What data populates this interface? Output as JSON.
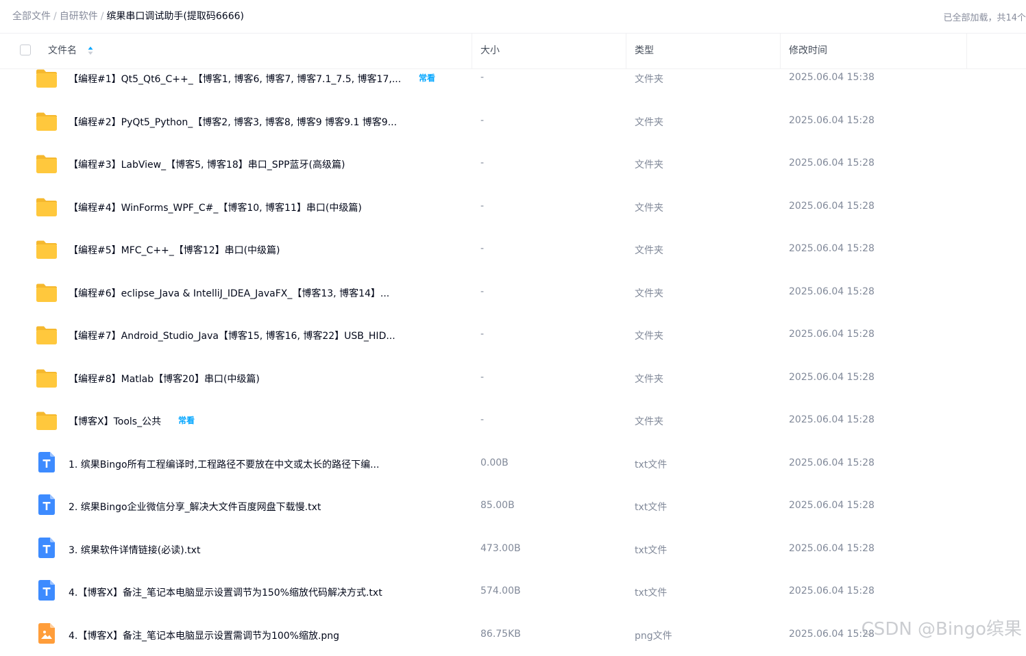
{
  "breadcrumb": {
    "items": [
      "全部文件",
      "自研软件",
      "缤果串口调试助手(提取码6666)"
    ],
    "separator": "/"
  },
  "status": {
    "loaded_text": "已全部加载，共14个"
  },
  "table": {
    "headers": {
      "name": "文件名",
      "size": "大小",
      "type": "类型",
      "modified": "修改时间"
    },
    "rows": [
      {
        "name": "【编程#1】Qt5_Qt6_C++_【博客1, 博客6, 博客7, 博客7.1_7.5, 博客17,...",
        "tag": "常看",
        "size": "-",
        "type": "文件夹",
        "modified": "2025.06.04 15:38",
        "icon": "folder-icon"
      },
      {
        "name": "【编程#2】PyQt5_Python_【博客2, 博客3, 博客8, 博客9 博客9.1 博客9...",
        "tag": "",
        "size": "-",
        "type": "文件夹",
        "modified": "2025.06.04 15:28",
        "icon": "folder-icon"
      },
      {
        "name": "【编程#3】LabView_【博客5, 博客18】串口_SPP蓝牙(高级篇)",
        "tag": "",
        "size": "-",
        "type": "文件夹",
        "modified": "2025.06.04 15:28",
        "icon": "folder-icon"
      },
      {
        "name": "【编程#4】WinForms_WPF_C#_【博客10, 博客11】串口(中级篇)",
        "tag": "",
        "size": "-",
        "type": "文件夹",
        "modified": "2025.06.04 15:28",
        "icon": "folder-icon"
      },
      {
        "name": "【编程#5】MFC_C++_【博客12】串口(中级篇)",
        "tag": "",
        "size": "-",
        "type": "文件夹",
        "modified": "2025.06.04 15:28",
        "icon": "folder-icon"
      },
      {
        "name": "【编程#6】eclipse_Java & IntelliJ_IDEA_JavaFX_【博客13, 博客14】...",
        "tag": "",
        "size": "-",
        "type": "文件夹",
        "modified": "2025.06.04 15:28",
        "icon": "folder-icon"
      },
      {
        "name": "【编程#7】Android_Studio_Java【博客15, 博客16, 博客22】USB_HID...",
        "tag": "",
        "size": "-",
        "type": "文件夹",
        "modified": "2025.06.04 15:28",
        "icon": "folder-icon"
      },
      {
        "name": "【编程#8】Matlab【博客20】串口(中级篇)",
        "tag": "",
        "size": "-",
        "type": "文件夹",
        "modified": "2025.06.04 15:28",
        "icon": "folder-icon"
      },
      {
        "name": "【博客X】Tools_公共",
        "tag": "常看",
        "size": "-",
        "type": "文件夹",
        "modified": "2025.06.04 15:28",
        "icon": "folder-icon"
      },
      {
        "name": "1. 缤果Bingo所有工程编译时,工程路径不要放在中文或太长的路径下编...",
        "tag": "",
        "size": "0.00B",
        "type": "txt文件",
        "modified": "2025.06.04 15:28",
        "icon": "txt-file-icon"
      },
      {
        "name": "2. 缤果Bingo企业微信分享_解决大文件百度网盘下载慢.txt",
        "tag": "",
        "size": "85.00B",
        "type": "txt文件",
        "modified": "2025.06.04 15:28",
        "icon": "txt-file-icon"
      },
      {
        "name": "3. 缤果软件详情链接(必读).txt",
        "tag": "",
        "size": "473.00B",
        "type": "txt文件",
        "modified": "2025.06.04 15:28",
        "icon": "txt-file-icon"
      },
      {
        "name": "4.【博客X】备注_笔记本电脑显示设置调节为150%缩放代码解决方式.txt",
        "tag": "",
        "size": "574.00B",
        "type": "txt文件",
        "modified": "2025.06.04 15:28",
        "icon": "txt-file-icon"
      },
      {
        "name": "4.【博客X】备注_笔记本电脑显示设置需调节为100%缩放.png",
        "tag": "",
        "size": "86.75KB",
        "type": "png文件",
        "modified": "2025.06.04 15:28",
        "icon": "png-file-icon"
      }
    ]
  },
  "watermark": "CSDN @Bingo缤果",
  "colors": {
    "accent": "#06a7ff",
    "folder": "#ffc83d",
    "txt_icon": "#3d8bff",
    "png_icon": "#ff9d3a"
  }
}
